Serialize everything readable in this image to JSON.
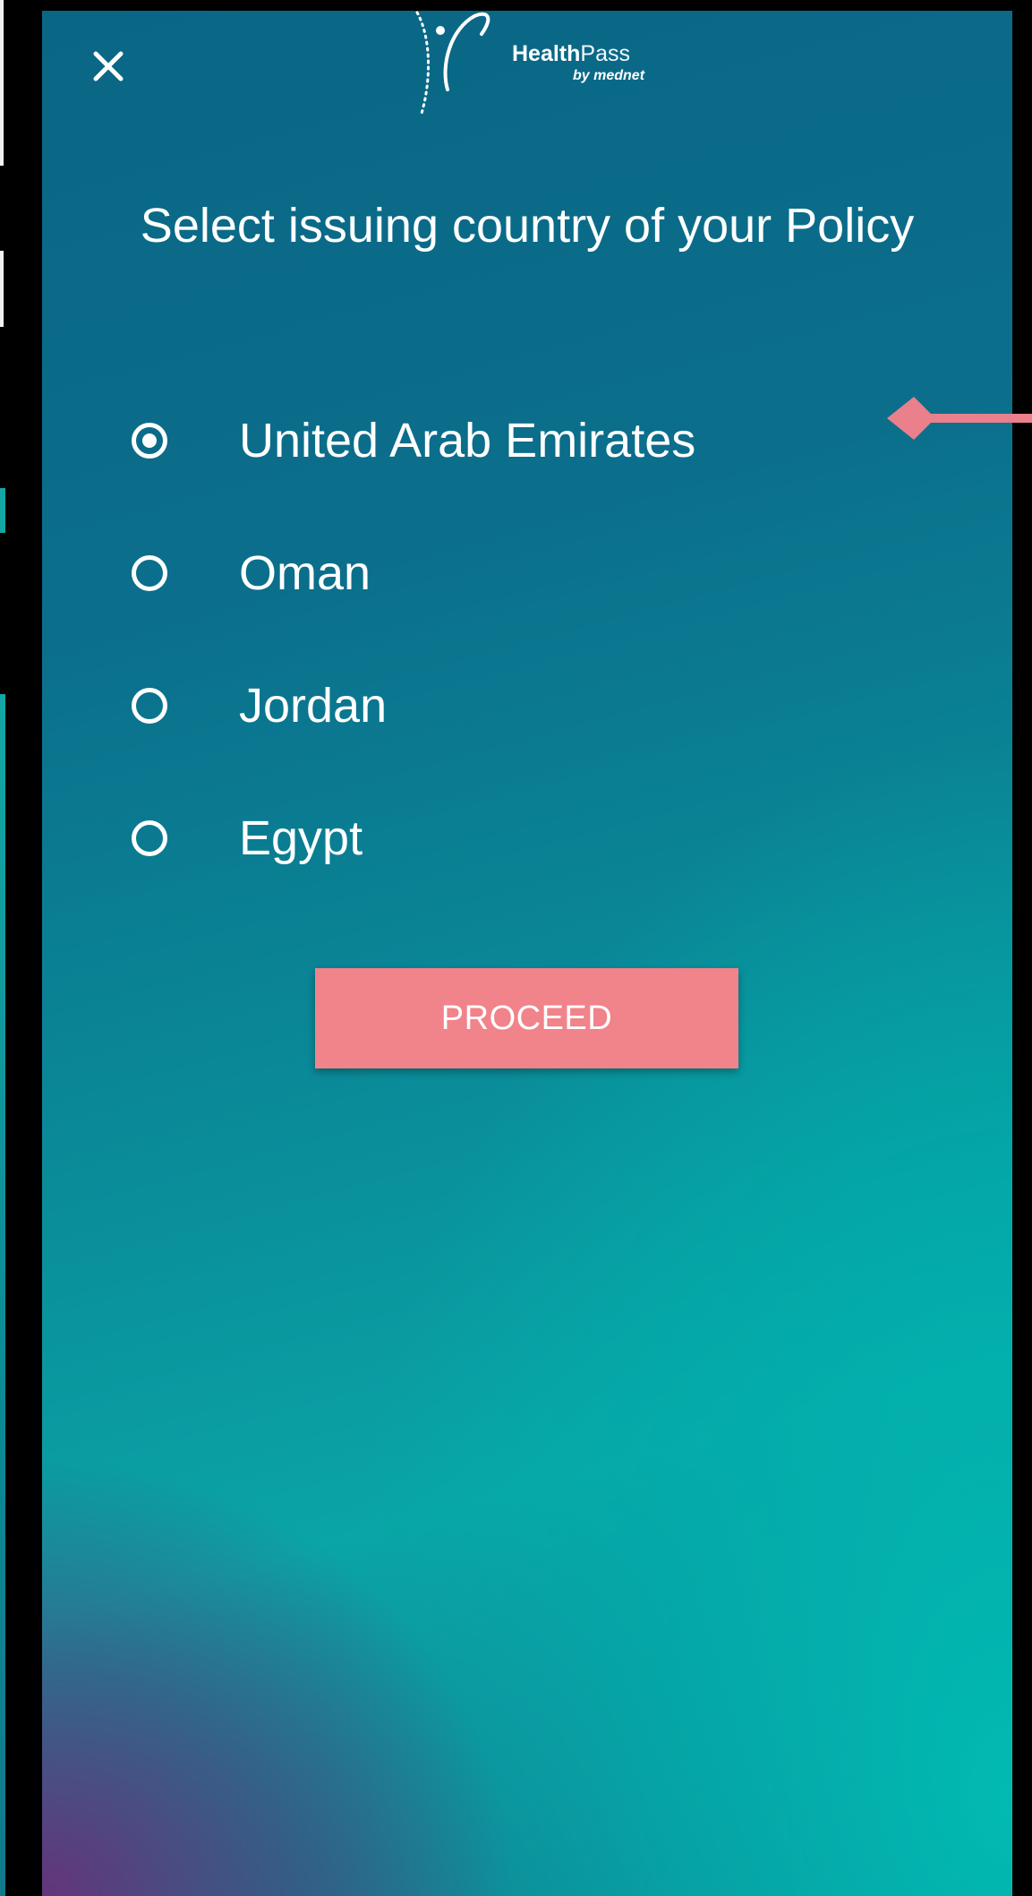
{
  "header": {
    "close_icon": "close-icon",
    "logo": {
      "name_bold": "Health",
      "name_light": "Pass",
      "sub": "by mednet"
    }
  },
  "main": {
    "title": "Select issuing country of your Policy",
    "countries": [
      {
        "label": "United Arab Emirates",
        "selected": true
      },
      {
        "label": "Oman",
        "selected": false
      },
      {
        "label": "Jordan",
        "selected": false
      },
      {
        "label": "Egypt",
        "selected": false
      }
    ],
    "proceed_label": "PROCEED"
  },
  "colors": {
    "accent": "#f1838a",
    "pointer": "#e9808b",
    "text": "#ffffff",
    "gradient_top": "#0a6685",
    "gradient_teal": "#00bdb3",
    "gradient_purple": "#68307a"
  }
}
